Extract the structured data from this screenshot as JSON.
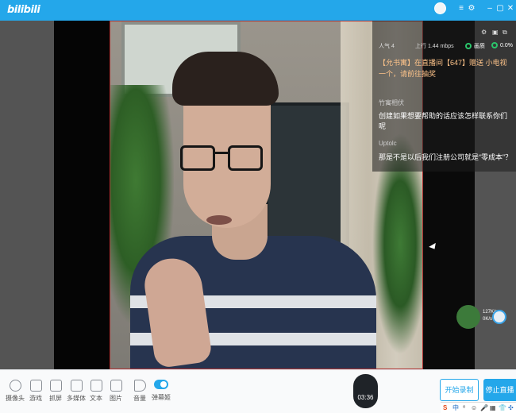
{
  "title_bar": {
    "logo": "bilibili",
    "menu_icon": "≡",
    "settings_icon": "⚙",
    "minimize_icon": "–",
    "maximize_icon": "▢",
    "close_icon": "✕"
  },
  "chat": {
    "popularity_label": "人气 4",
    "upload_label": "上行 1.44 mbps",
    "quality_label": "画质",
    "loss_label": "0.0%",
    "messages": [
      {
        "type": "gift",
        "text": "【允书寓】在直播间【647】赠送 小电视一个，请前往抽奖"
      },
      {
        "type": "chat",
        "user": "竹寓相伏",
        "text": "创建如果想要帮助的话应该怎样联系你们呢"
      },
      {
        "type": "chat",
        "user": "Uptolc",
        "text": "那是不是以后我们注册公司就是“零成本”？"
      }
    ]
  },
  "float_badge": {
    "line1": "127K/s",
    "line2": "0K/s"
  },
  "toolbar": {
    "tools": [
      {
        "label": "摄像头",
        "icon": "camera-icon"
      },
      {
        "label": "游戏",
        "icon": "gamepad-icon"
      },
      {
        "label": "抓屏",
        "icon": "screen-capture-icon"
      },
      {
        "label": "多媒体",
        "icon": "media-icon"
      },
      {
        "label": "文本",
        "icon": "text-icon"
      },
      {
        "label": "图片",
        "icon": "image-icon"
      },
      {
        "label": "音量",
        "icon": "volume-icon"
      },
      {
        "label": "弹幕姬",
        "icon": "danmaku-toggle-icon"
      }
    ],
    "timer": "03:36",
    "record_button": "开始录制",
    "stop_button": "停止直播"
  },
  "tray": {
    "icons": [
      "S",
      "中",
      "⁰",
      "☺",
      "🎤",
      "▦",
      "👕",
      "✣"
    ]
  },
  "colors": {
    "accent": "#24a7ea",
    "gift_text": "#ffc48a",
    "quality_dot": "#2bc56b"
  }
}
